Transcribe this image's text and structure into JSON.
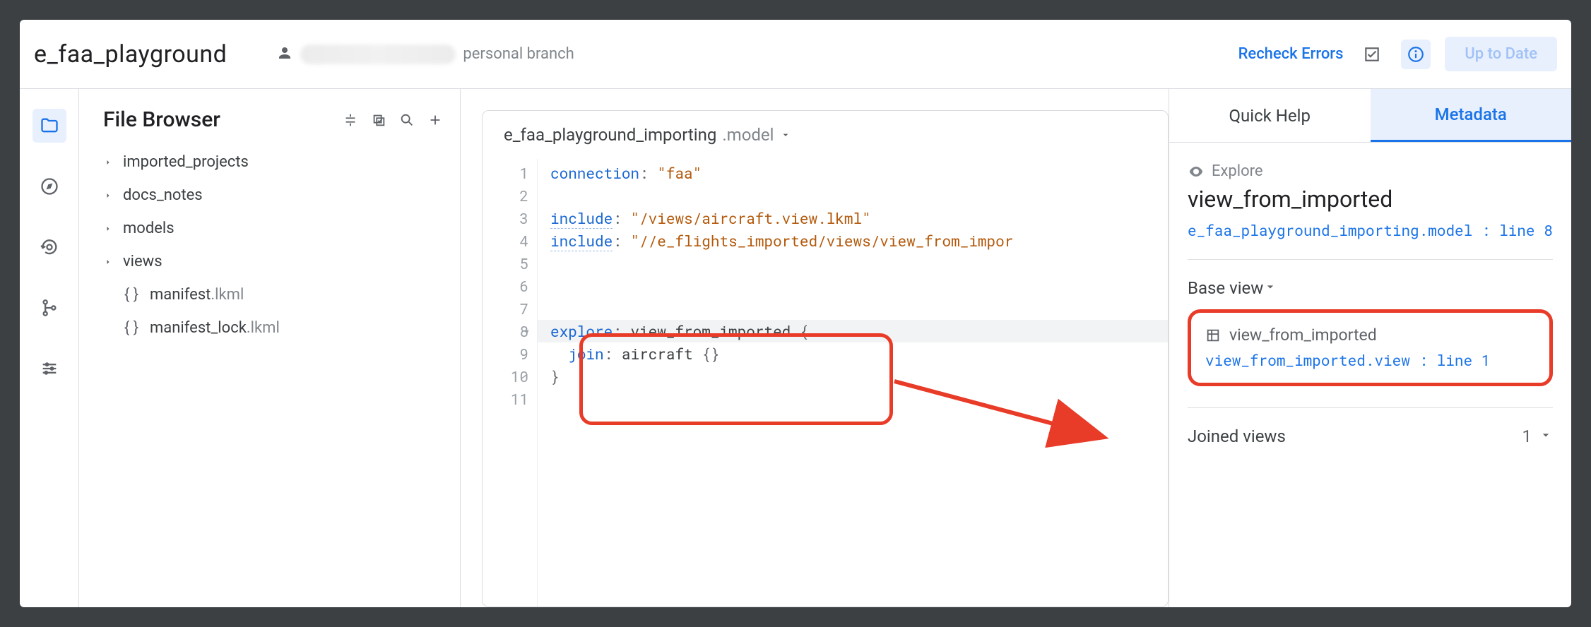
{
  "header": {
    "project_title": "e_faa_playground",
    "branch_label": "personal branch",
    "recheck_label": "Recheck Errors",
    "uptodate_label": "Up to Date"
  },
  "file_browser": {
    "title": "File Browser",
    "folders": [
      "imported_projects",
      "docs_notes",
      "models",
      "views"
    ],
    "files": [
      {
        "name": "manifest",
        "ext": ".lkml"
      },
      {
        "name": "manifest_lock",
        "ext": ".lkml"
      }
    ]
  },
  "editor": {
    "tab_name": "e_faa_playground_importing",
    "tab_ext": ".model",
    "lines": [
      {
        "n": 1,
        "kind": "kv",
        "key": "connection",
        "val": "\"faa\"",
        "underline": false
      },
      {
        "n": 2,
        "kind": "blank"
      },
      {
        "n": 3,
        "kind": "kv",
        "key": "include",
        "val": "\"/views/aircraft.view.lkml\"",
        "underline": true
      },
      {
        "n": 4,
        "kind": "kv",
        "key": "include",
        "val": "\"//e_flights_imported/views/view_from_impor",
        "underline": true
      },
      {
        "n": 5,
        "kind": "blank"
      },
      {
        "n": 6,
        "kind": "blank"
      },
      {
        "n": 7,
        "kind": "blank"
      },
      {
        "n": 8,
        "kind": "explore_open",
        "key": "explore",
        "id": "view_from_imported",
        "hl": true,
        "fold": true
      },
      {
        "n": 9,
        "kind": "join",
        "key": "join",
        "id": "aircraft"
      },
      {
        "n": 10,
        "kind": "close"
      },
      {
        "n": 11,
        "kind": "blank"
      }
    ]
  },
  "right_panel": {
    "tab_quickhelp": "Quick Help",
    "tab_metadata": "Metadata",
    "kind_label": "Explore",
    "object_name": "view_from_imported",
    "object_location": "e_faa_playground_importing.model : line 8",
    "base_view_heading": "Base view",
    "base_view_name": "view_from_imported",
    "base_view_location": "view_from_imported.view : line 1",
    "joined_heading": "Joined views",
    "joined_count": "1"
  }
}
